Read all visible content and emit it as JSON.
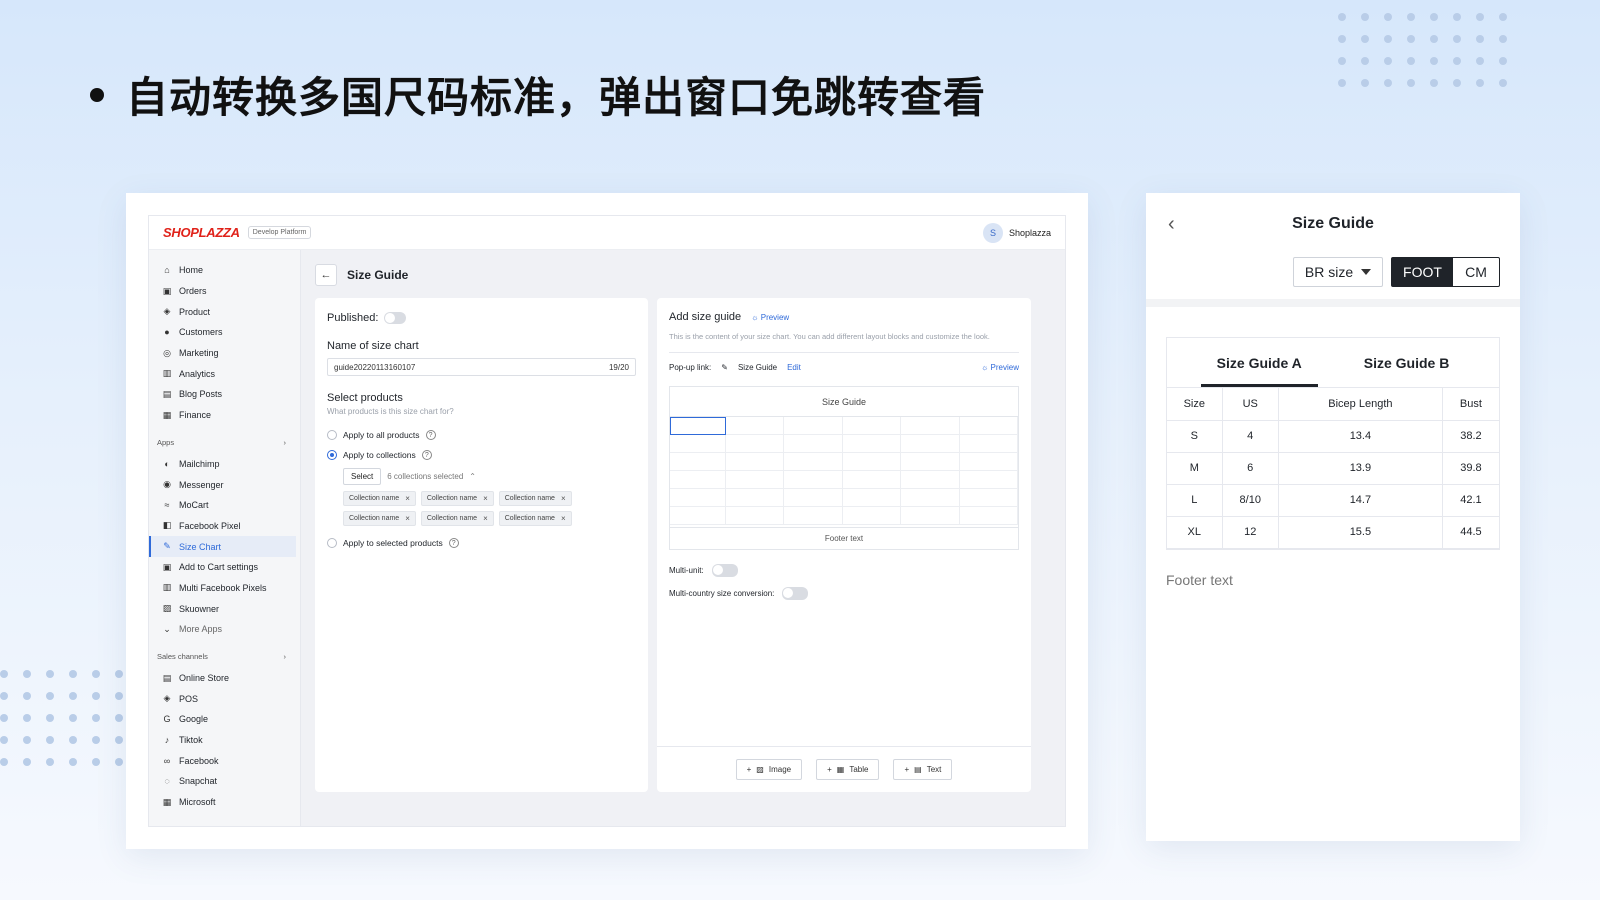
{
  "headline": "自动转换多国尺码标准，弹出窗口免跳转查看",
  "admin": {
    "brand": "SHOPLAZZA",
    "badge": "Develop Platform",
    "user": {
      "initial": "S",
      "name": "Shoplazza"
    },
    "nav_main": [
      {
        "label": "Home",
        "icon": "home-icon",
        "glyph": "⌂"
      },
      {
        "label": "Orders",
        "icon": "orders-icon",
        "glyph": "▣"
      },
      {
        "label": "Product",
        "icon": "tag-icon",
        "glyph": "◈"
      },
      {
        "label": "Customers",
        "icon": "person-icon",
        "glyph": "●"
      },
      {
        "label": "Marketing",
        "icon": "target-icon",
        "glyph": "◎"
      },
      {
        "label": "Analytics",
        "icon": "bar-chart-icon",
        "glyph": "▥"
      },
      {
        "label": "Blog Posts",
        "icon": "blog-icon",
        "glyph": "▤"
      },
      {
        "label": "Finance",
        "icon": "finance-icon",
        "glyph": "▦"
      }
    ],
    "apps_label": "Apps",
    "nav_apps": [
      {
        "label": "Mailchimp",
        "icon": "mailchimp-icon",
        "glyph": "◐"
      },
      {
        "label": "Messenger",
        "icon": "messenger-icon",
        "glyph": "◉"
      },
      {
        "label": "MoCart",
        "icon": "mocart-icon",
        "glyph": "≈"
      },
      {
        "label": "Facebook Pixel",
        "icon": "code-icon",
        "glyph": "◧"
      },
      {
        "label": "Size Chart",
        "icon": "edit-icon",
        "glyph": "✎"
      },
      {
        "label": "Add to Cart settings",
        "icon": "cart-icon",
        "glyph": "▣"
      },
      {
        "label": "Multi Facebook Pixels",
        "icon": "pixels-icon",
        "glyph": "▥"
      },
      {
        "label": "Skuowner",
        "icon": "skuowner-icon",
        "glyph": "▨"
      },
      {
        "label": "More Apps",
        "icon": "chevron-down-icon",
        "glyph": "⌄"
      }
    ],
    "sales_label": "Sales channels",
    "nav_sales": [
      {
        "label": "Online Store",
        "icon": "store-icon",
        "glyph": "▤"
      },
      {
        "label": "POS",
        "icon": "pos-icon",
        "glyph": "◈"
      },
      {
        "label": "Google",
        "icon": "google-icon",
        "glyph": "G"
      },
      {
        "label": "Tiktok",
        "icon": "tiktok-icon",
        "glyph": "♪"
      },
      {
        "label": "Facebook",
        "icon": "meta-icon",
        "glyph": "∞"
      },
      {
        "label": "Snapchat",
        "icon": "snapchat-icon",
        "glyph": "◌"
      },
      {
        "label": "Microsoft",
        "icon": "microsoft-icon",
        "glyph": "▦"
      }
    ],
    "page_title": "Size Guide",
    "left_panel": {
      "published_label": "Published:",
      "name_label": "Name of size chart",
      "name_value": "guide20220113160107",
      "name_count": "19/20",
      "select_label": "Select products",
      "select_hint": "What products is this size chart for?",
      "opt_all": "Apply to all products",
      "opt_collections": "Apply to collections",
      "select_btn": "Select",
      "selected_text": "6 collections selected",
      "chips": [
        "Collection name",
        "Collection name",
        "Collection name",
        "Collection name",
        "Collection name",
        "Collection name"
      ],
      "opt_selected": "Apply to selected products"
    },
    "right_panel": {
      "title": "Add size guide",
      "preview": "Preview",
      "desc": "This is the content of your size chart. You can add different layout blocks and customize the look.",
      "popup_label": "Pop-up link:",
      "popup_value": "Size Guide",
      "edit": "Edit",
      "preview2": "Preview",
      "grid_title": "Size Guide",
      "grid_footer": "Footer text",
      "multi_unit": "Multi-unit:",
      "multi_country": "Multi-country size conversion:",
      "btn_image": "Image",
      "btn_table": "Table",
      "btn_text": "Text"
    }
  },
  "popup": {
    "title": "Size Guide",
    "dropdown": "BR size",
    "unit_on": "FOOT",
    "unit_off": "CM",
    "tab_a": "Size Guide A",
    "tab_b": "Size Guide B",
    "headers": [
      "Size",
      "US",
      "Bicep Length",
      "Bust"
    ],
    "rows": [
      [
        "S",
        "4",
        "13.4",
        "38.2"
      ],
      [
        "M",
        "6",
        "13.9",
        "39.8"
      ],
      [
        "L",
        "8/10",
        "14.7",
        "42.1"
      ],
      [
        "XL",
        "12",
        "15.5",
        "44.5"
      ]
    ],
    "footer": "Footer text"
  }
}
